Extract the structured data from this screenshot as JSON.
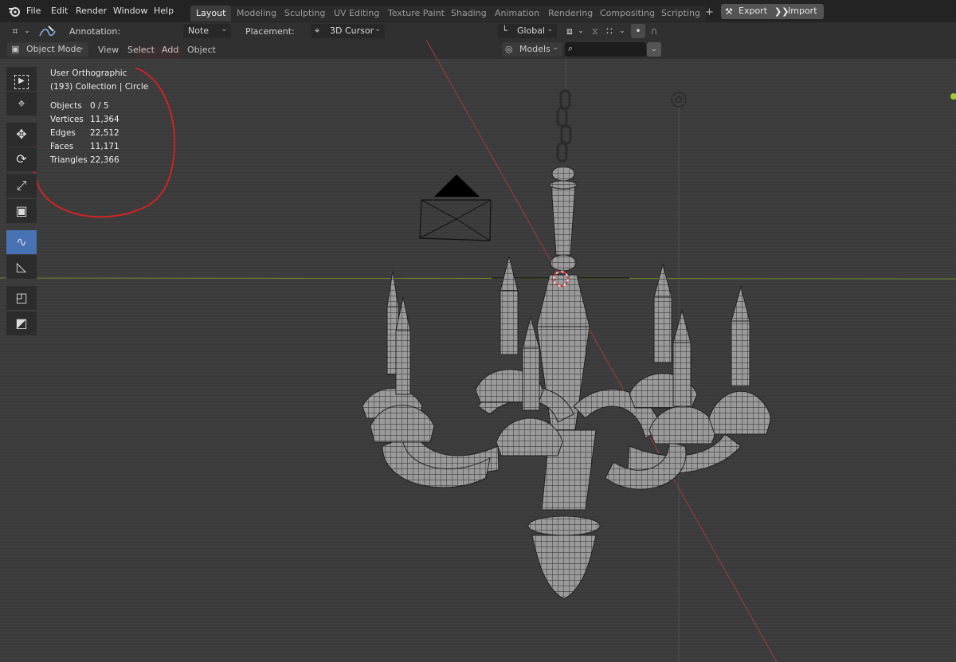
{
  "menu": [
    "File",
    "Edit",
    "Render",
    "Window",
    "Help"
  ],
  "workspaces": [
    {
      "label": "Layout",
      "active": true
    },
    {
      "label": "Modeling"
    },
    {
      "label": "Sculpting"
    },
    {
      "label": "UV Editing"
    },
    {
      "label": "Texture Paint"
    },
    {
      "label": "Shading"
    },
    {
      "label": "Animation"
    },
    {
      "label": "Rendering"
    },
    {
      "label": "Compositing"
    },
    {
      "label": "Scripting"
    }
  ],
  "header_buttons": {
    "export": "Export",
    "import": "Import"
  },
  "tool_settings": {
    "annotation_label": "Annotation:",
    "annotation_color": "#d42a2a",
    "note_value": "Note",
    "placement_label": "Placement:",
    "placement_value": "3D Cursor",
    "orientation_value": "Global"
  },
  "viewport_header": {
    "mode": "Object Mode",
    "view": "View",
    "select": "Select",
    "add": "Add",
    "object": "Object",
    "models": "Models",
    "search_value": ""
  },
  "overlay": {
    "view_name": "User Orthographic",
    "collection": "(193) Collection | Circle",
    "stats": [
      {
        "label": "Objects",
        "value": "0 / 5"
      },
      {
        "label": "Vertices",
        "value": "11,364"
      },
      {
        "label": "Edges",
        "value": "22,512"
      },
      {
        "label": "Faces",
        "value": "11,171"
      },
      {
        "label": "Triangles",
        "value": "22,366"
      }
    ]
  },
  "toolbar_icons": [
    "select-box-icon",
    "cursor-icon",
    "move-icon",
    "rotate-icon",
    "scale-icon",
    "transform-icon",
    "annotate-icon",
    "measure-icon",
    "add-cube-icon",
    "add-plane-icon"
  ]
}
